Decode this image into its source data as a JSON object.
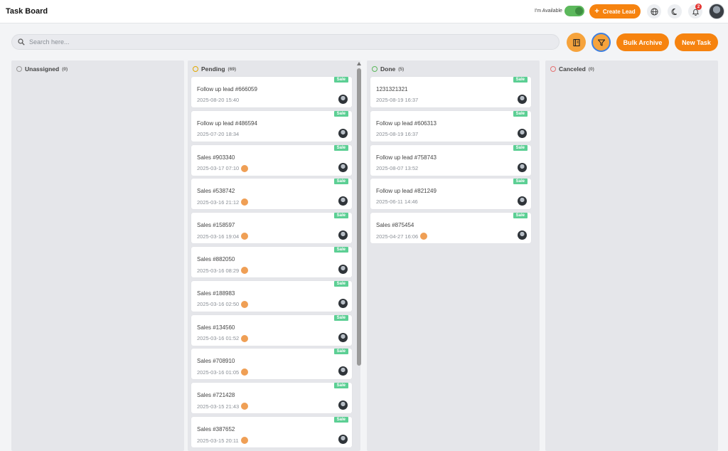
{
  "header": {
    "title": "Task Board",
    "availability_label": "I'm Available",
    "create_lead_label": "Create Lead",
    "notification_count": "2"
  },
  "toolbar": {
    "search_placeholder": "Search here...",
    "bulk_archive_label": "Bulk Archive",
    "new_task_label": "New Task"
  },
  "colors": {
    "accent": "#f6830f",
    "tag": "#5ccf94",
    "pending": "#e0a800",
    "done": "#5cb85c",
    "canceled": "#e57373",
    "unassigned": "#999999"
  },
  "columns": [
    {
      "id": "unassigned",
      "title": "Unassigned",
      "count": "(0)",
      "cards": []
    },
    {
      "id": "pending",
      "title": "Pending",
      "count": "(69)",
      "cards": [
        {
          "tag": "Sale",
          "title": "Follow up lead #666059",
          "date": "2025-08-20 15:40",
          "priority": false
        },
        {
          "tag": "Sale",
          "title": "Follow up lead #486594",
          "date": "2025-07-20 18:34",
          "priority": false
        },
        {
          "tag": "Sale",
          "title": "Sales #903340",
          "date": "2025-03-17 07:10",
          "priority": true
        },
        {
          "tag": "Sale",
          "title": "Sales #538742",
          "date": "2025-03-16 21:12",
          "priority": true
        },
        {
          "tag": "Sale",
          "title": "Sales #158597",
          "date": "2025-03-16 19:04",
          "priority": true
        },
        {
          "tag": "Sale",
          "title": "Sales #882050",
          "date": "2025-03-16 08:29",
          "priority": true
        },
        {
          "tag": "Sale",
          "title": "Sales #188983",
          "date": "2025-03-16 02:50",
          "priority": true
        },
        {
          "tag": "Sale",
          "title": "Sales #134560",
          "date": "2025-03-16 01:52",
          "priority": true
        },
        {
          "tag": "Sale",
          "title": "Sales #708910",
          "date": "2025-03-16 01:05",
          "priority": true
        },
        {
          "tag": "Sale",
          "title": "Sales #721428",
          "date": "2025-03-15 21:43",
          "priority": true
        },
        {
          "tag": "Sale",
          "title": "Sales #387652",
          "date": "2025-03-15 20:11",
          "priority": true
        }
      ]
    },
    {
      "id": "done",
      "title": "Done",
      "count": "(5)",
      "cards": [
        {
          "tag": "Sale",
          "title": "1231321321",
          "date": "2025-08-19 16:37",
          "priority": false
        },
        {
          "tag": "Sale",
          "title": "Follow up lead #606313",
          "date": "2025-08-19 16:37",
          "priority": false
        },
        {
          "tag": "Sale",
          "title": "Follow up lead #758743",
          "date": "2025-08-07 13:52",
          "priority": false
        },
        {
          "tag": "Sale",
          "title": "Follow up lead #821249",
          "date": "2025-06-11 14:46",
          "priority": false
        },
        {
          "tag": "Sale",
          "title": "Sales #875454",
          "date": "2025-04-27 16:06",
          "priority": true
        }
      ]
    },
    {
      "id": "canceled",
      "title": "Canceled",
      "count": "(0)",
      "cards": []
    }
  ],
  "icons": {
    "globe": "globe-icon",
    "theme": "moon-icon",
    "notifications": "bell-icon",
    "search": "search-icon",
    "book": "book-icon",
    "filter": "filter-icon"
  }
}
